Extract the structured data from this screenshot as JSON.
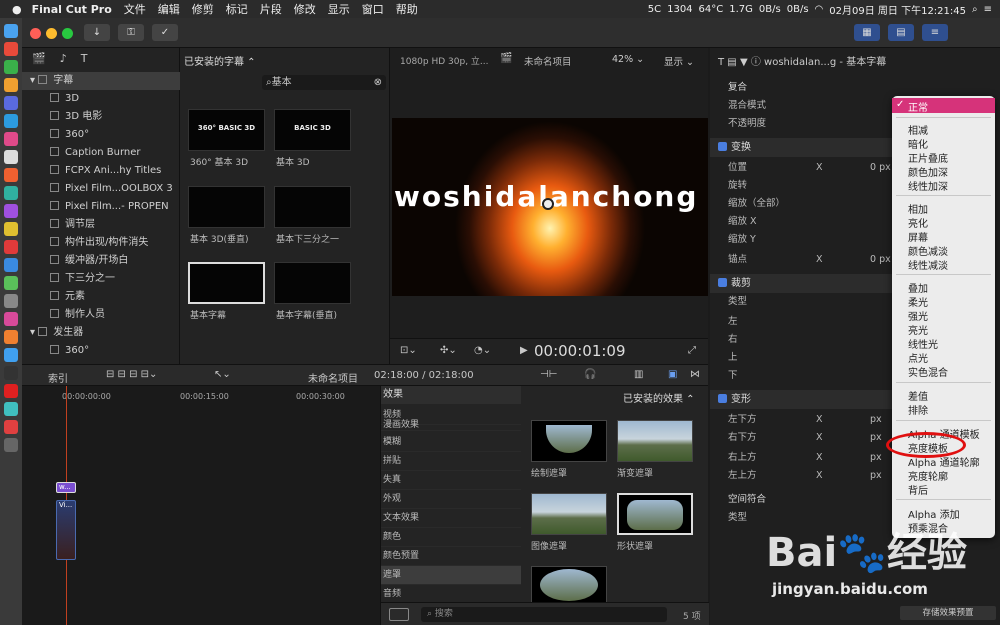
{
  "menubar": {
    "app": "Final Cut Pro",
    "items": [
      "文件",
      "编辑",
      "修剪",
      "标记",
      "片段",
      "修改",
      "显示",
      "窗口",
      "帮助"
    ],
    "cpu": "5C",
    "cpu_freq": "1304",
    "cpu2": "64°C",
    "freq2": "1.7G",
    "net_up": "0B/s",
    "net_down": "0B/s",
    "datetime": "02月09日 周日 下午12:21:45"
  },
  "browser": {
    "title": "已安装的字幕",
    "search": "基本",
    "library": {
      "cat": "字幕",
      "items": [
        "3D",
        "3D 电影",
        "360°",
        "Caption Burner",
        "FCPX Ani...hy Titles",
        "Pixel Film...OOLBOX 3",
        "Pixel Film...- PROPEN",
        "调节层",
        "构件出现/构件消失",
        "缓冲器/开场白",
        "下三分之一",
        "元素",
        "制作人员"
      ],
      "gen": "发生器",
      "gen_item": "360°"
    },
    "thumbs": [
      {
        "txt": "360° BASIC 3D",
        "label": "360° 基本 3D"
      },
      {
        "txt": "BASIC 3D",
        "label": "基本 3D"
      },
      {
        "txt": "",
        "label": "基本 3D(垂直)"
      },
      {
        "txt": "",
        "label": "基本下三分之一"
      },
      {
        "txt": "",
        "label": "基本字幕"
      },
      {
        "txt": "",
        "label": "基本字幕(垂直)"
      }
    ]
  },
  "viewer": {
    "format": "1080p HD 30p, 立...",
    "project": "未命名项目",
    "zoom": "42%",
    "view": "显示",
    "title_text": "woshidalanchong",
    "timecode": "00:00:01:09"
  },
  "inspector": {
    "header": "woshidalan...g - 基本字幕",
    "composite": "复合",
    "blend_mode": "混合模式",
    "opacity": "不透明度",
    "transform": "变换",
    "position": "位置",
    "rotation": "旋转",
    "scale_all": "缩放（全部）",
    "scale_x": "缩放 X",
    "scale_y": "缩放 Y",
    "anchor": "锚点",
    "crop": "裁剪",
    "type": "类型",
    "left": "左",
    "right": "右",
    "top": "上",
    "bottom": "下",
    "distort": "变形",
    "bl": "左下方",
    "br": "右下方",
    "tr": "右上方",
    "tl": "左上方",
    "spatial": "空间符合",
    "type2": "类型",
    "x": "X",
    "px": "0 px",
    "px2": "px",
    "save": "存储效果预置"
  },
  "blend_menu": {
    "selected": "正常",
    "groups": [
      [
        "相减",
        "暗化",
        "正片叠底",
        "颜色加深",
        "线性加深"
      ],
      [
        "相加",
        "亮化",
        "屏幕",
        "颜色减淡",
        "线性减淡"
      ],
      [
        "叠加",
        "柔光",
        "强光",
        "亮光",
        "线性光",
        "点光",
        "实色混合"
      ],
      [
        "差值",
        "排除"
      ],
      [
        "Alpha 通道模板",
        "亮度模板",
        "Alpha 通道轮廓",
        "亮度轮廓",
        "背后"
      ],
      [
        "Alpha 添加",
        "预乘混合"
      ]
    ]
  },
  "timeline": {
    "index": "索引",
    "project": "未命名项目",
    "duration": "02:18:00 / 02:18:00",
    "t0": "00:00:00:00",
    "t1": "00:00:15:00",
    "t2": "00:00:30:00",
    "clip_title": "w...",
    "clip_video": "Vi..."
  },
  "effects": {
    "title": "效果",
    "installed": "已安装的效果",
    "cats": [
      "视频",
      "漫画效果",
      "模糊",
      "拼贴",
      "失真",
      "外观",
      "文本效果",
      "颜色",
      "颜色预置",
      "遮罩",
      "音频"
    ],
    "items": [
      "绘制遮罩",
      "渐变遮罩",
      "图像遮罩",
      "形状遮罩"
    ],
    "search": "搜索",
    "count": "5 项"
  },
  "watermark": {
    "logo": "Bai",
    "logo2": "经验",
    "url": "jingyan.baidu.com"
  },
  "colors": {
    "accent": "#d6337a",
    "select": "#4a7ee0",
    "highlight_ring": "#e01010"
  }
}
